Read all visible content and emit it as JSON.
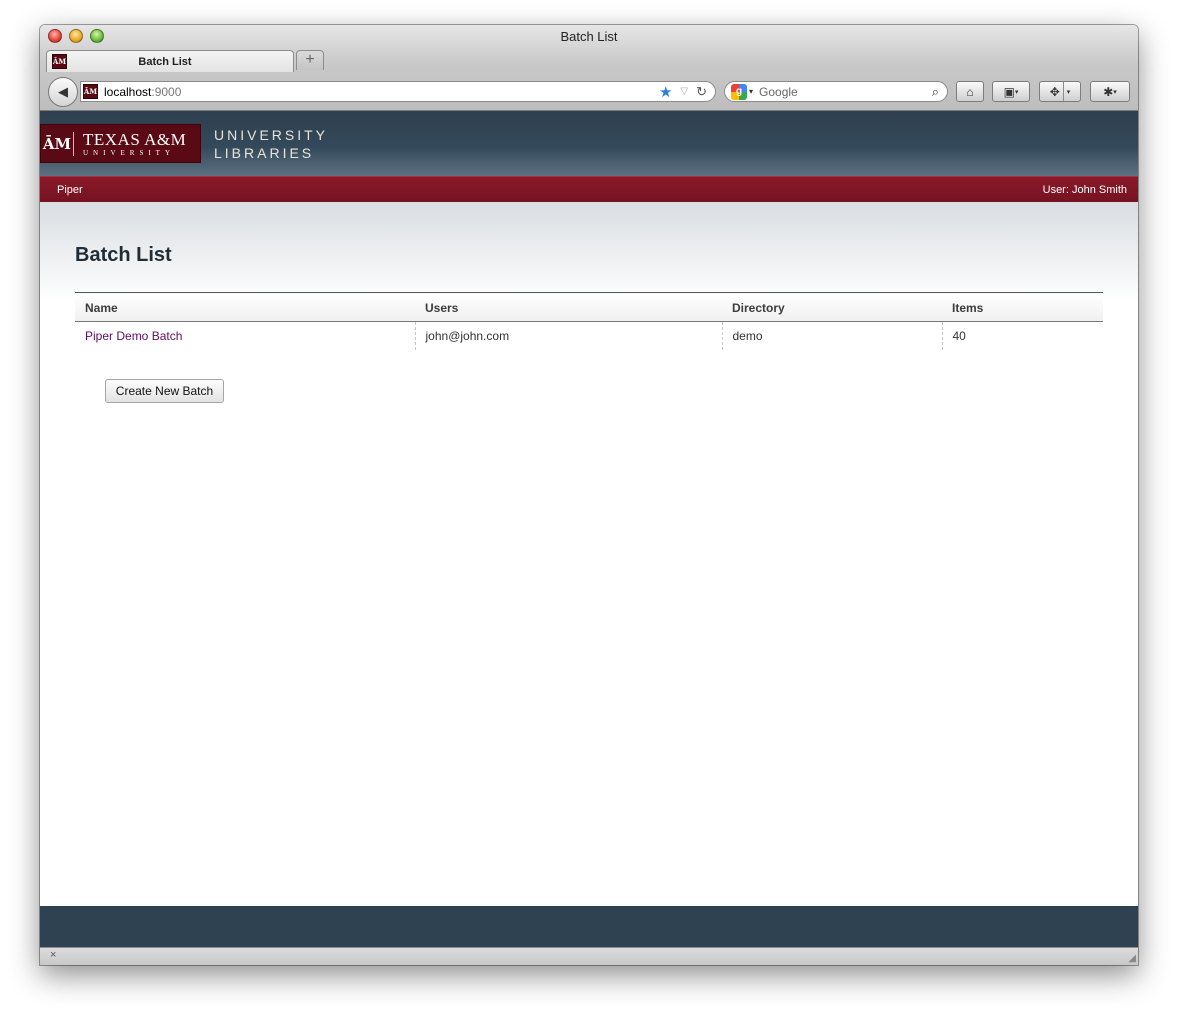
{
  "window": {
    "title": "Batch List"
  },
  "tabs": [
    {
      "label": "Batch List",
      "favicon": "ĀM"
    }
  ],
  "newtab_label": "+",
  "toolbar": {
    "back_icon": "◀",
    "url_host": "localhost",
    "url_port": ":9000",
    "star_icon": "★",
    "dropdown_icon": "▽",
    "reload_icon": "↻",
    "search_engine_letter": "g",
    "search_dropdown": "▾",
    "search_placeholder": "Google",
    "magnifier": "⌕",
    "home_icon": "⌂",
    "bookmarks_icon": "▣",
    "addon_icon": "✥",
    "extension_icon": "✱",
    "caret": "▾"
  },
  "site": {
    "logo_mark": "ĀM",
    "logo_big": "TEXAS A&M",
    "logo_small": "UNIVERSITY",
    "libraries_line1": "UNIVERSITY",
    "libraries_line2": "LIBRARIES",
    "nav_app": "Piper",
    "nav_user": "User: John Smith"
  },
  "main": {
    "title": "Batch List",
    "table": {
      "headers": [
        "Name",
        "Users",
        "Directory",
        "Items"
      ],
      "rows": [
        {
          "name": "Piper Demo Batch",
          "users": "john@john.com",
          "directory": "demo",
          "items": "40"
        }
      ]
    },
    "create_button": "Create New Batch"
  },
  "statusbar": {
    "close_icon": "×",
    "resize_icon": "◢"
  }
}
